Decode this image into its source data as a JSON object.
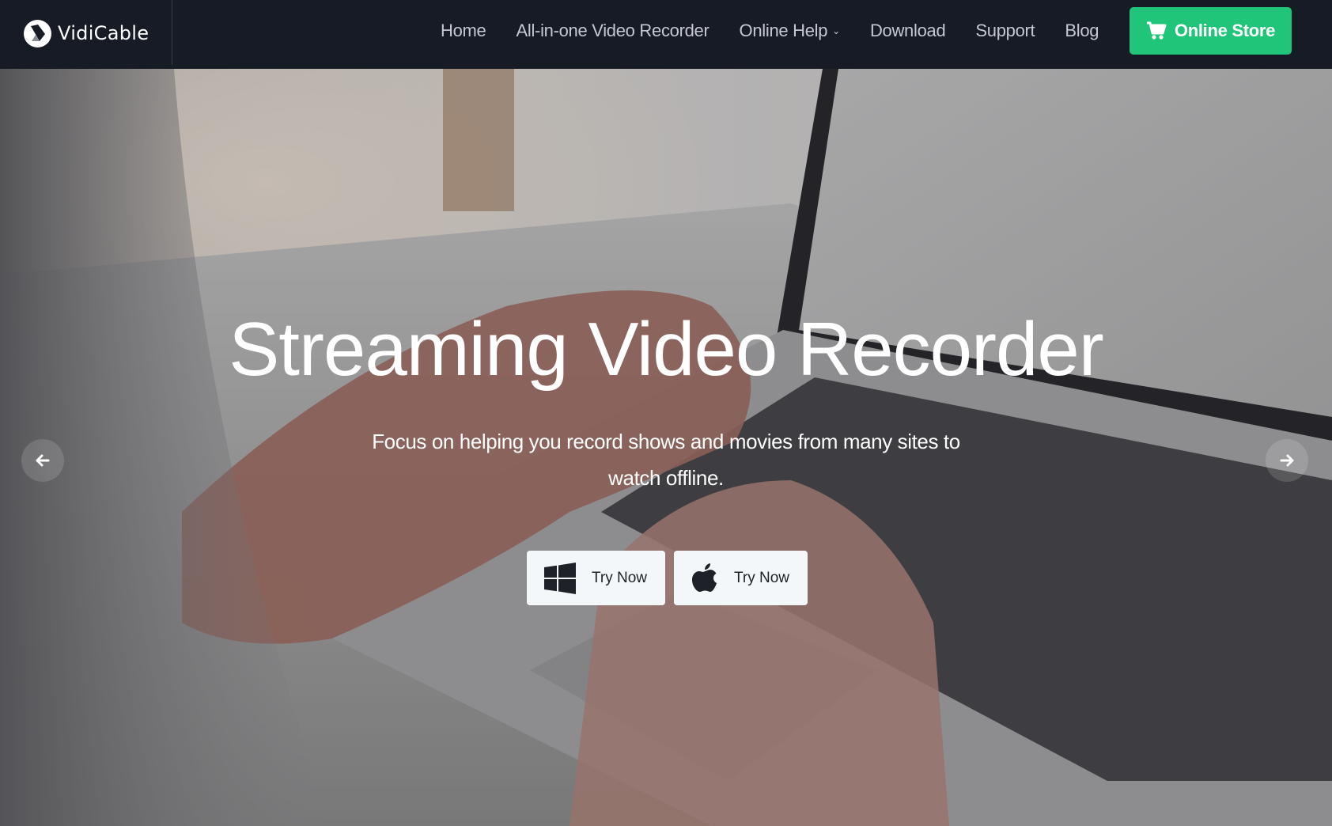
{
  "brand": {
    "name": "VidiCable",
    "accent_color": "#21c57a",
    "nav_bg_color": "#161b26"
  },
  "nav": {
    "items": [
      {
        "label": "Home",
        "has_dropdown": false
      },
      {
        "label": "All-in-one Video Recorder",
        "has_dropdown": false
      },
      {
        "label": "Online Help",
        "has_dropdown": true
      },
      {
        "label": "Download",
        "has_dropdown": false
      },
      {
        "label": "Support",
        "has_dropdown": false
      },
      {
        "label": "Blog",
        "has_dropdown": false
      }
    ],
    "dropdown_icon": "chevron-down-icon",
    "store_button": {
      "label": "Online Store",
      "icon": "shopping-cart-icon"
    }
  },
  "hero": {
    "title": "Streaming Video Recorder",
    "subtitle": "Focus on helping you record shows and movies from many sites to watch offline.",
    "buttons": [
      {
        "label": "Try Now",
        "icon": "windows-icon",
        "platform": "Windows"
      },
      {
        "label": "Try Now",
        "icon": "apple-icon",
        "platform": "Mac"
      }
    ],
    "prev_arrow_icon": "arrow-left-icon",
    "next_arrow_icon": "arrow-right-icon"
  }
}
